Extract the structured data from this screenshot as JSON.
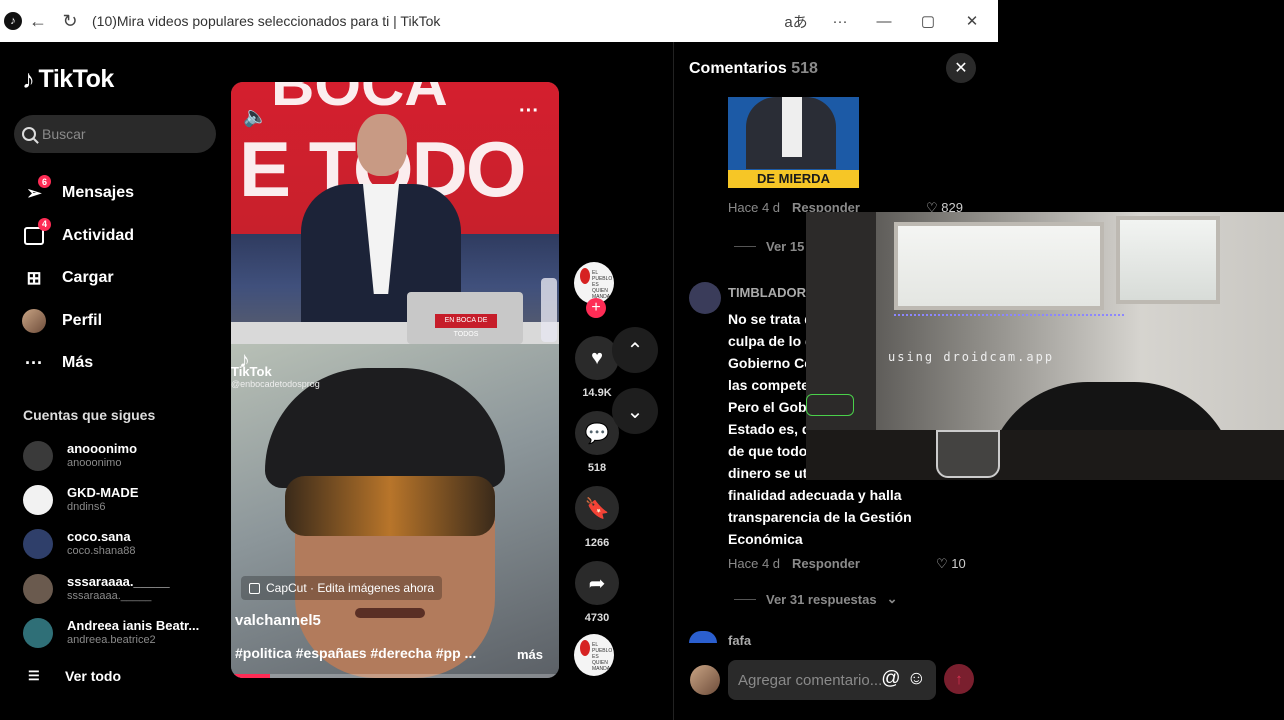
{
  "browser": {
    "title": "(10)Mira videos populares seleccionados para ti | TikTok",
    "back_icon": "←",
    "reload_icon": "↻",
    "read_aloud_icon": "a͏あ",
    "menu_icon": "···",
    "minimize_icon": "—",
    "maximize_icon": "▢",
    "close_icon": "✕"
  },
  "sidebar": {
    "logo_text": "TikTok",
    "search_placeholder": "Buscar",
    "nav": [
      {
        "label": "Mensajes",
        "badge": "6",
        "icon": "send-icon"
      },
      {
        "label": "Actividad",
        "badge": "4",
        "icon": "inbox-icon"
      },
      {
        "label": "Cargar",
        "badge": "",
        "icon": "upload-icon"
      },
      {
        "label": "Perfil",
        "badge": "",
        "icon": "avatar-icon"
      },
      {
        "label": "Más",
        "badge": "",
        "icon": "more-icon"
      }
    ],
    "following_title": "Cuentas que sigues",
    "following": [
      {
        "name": "anooonimo",
        "handle": "anooonimo",
        "color": "#3a3a3a"
      },
      {
        "name": "GKD-MADE",
        "handle": "dndins6",
        "color": "#f2f2f2"
      },
      {
        "name": "coco.sana",
        "handle": "coco.shana88",
        "color": "#2f3f6a"
      },
      {
        "name": "sssaraaaa._____",
        "handle": "sssaraaaa._____",
        "color": "#6a5a4e"
      },
      {
        "name": "Andreea ianis Beatr...",
        "handle": "andreea.beatrice2",
        "color": "#2f6f77"
      }
    ],
    "see_all": "Ver todo"
  },
  "video": {
    "top_text_1": "BOCA",
    "top_text_2": "E TODO",
    "laptop_label": "EN BOCA DE TODOS",
    "watermark_logo": "♪",
    "watermark_brand": "TikTok",
    "watermark_handle": "@enbocadetodosprog",
    "capcut_label": "CapCut · Edita imágenes ahora",
    "author": "valchannel5",
    "hashtags": "#politica #españaᴇs #derecha #pp ...",
    "more_label": "más",
    "progress": 0.12
  },
  "actions": {
    "avatar_text": "EL PUEBLO ES QUIEN MANDA",
    "likes": "14.9K",
    "comments": "518",
    "saves": "1266",
    "shares": "4730"
  },
  "comments": {
    "title": "Comentarios",
    "count": "518",
    "image_caption": "DE MIERDA",
    "first_time": "Hace 4 d",
    "reply_label": "Responder",
    "first_likes": "829",
    "first_views": "Ver 15",
    "second_user": "TIMBLADOR",
    "second_text": "No se trata d\nculpa de lo d\nGobierno Ce\nlas compete\nPero el Gob\nEstado es, d\nde que todo\ndinero se uti\nfinalidad adecuada y halla\ntransparencia de la Gestión\nEconómica",
    "second_time": "Hace 4 d",
    "second_likes": "10",
    "second_views": "Ver 31 respuestas",
    "third_user": "fafa",
    "input_placeholder": "Agregar comentario...",
    "mention_icon": "@",
    "emoji_icon": "☺",
    "send_icon": "↑"
  },
  "webcam": {
    "watermark": "using droidcam.app"
  },
  "colors": {
    "accent": "#fe2c55",
    "panel": "#2a2a2a",
    "muted": "#8a8a8a"
  }
}
